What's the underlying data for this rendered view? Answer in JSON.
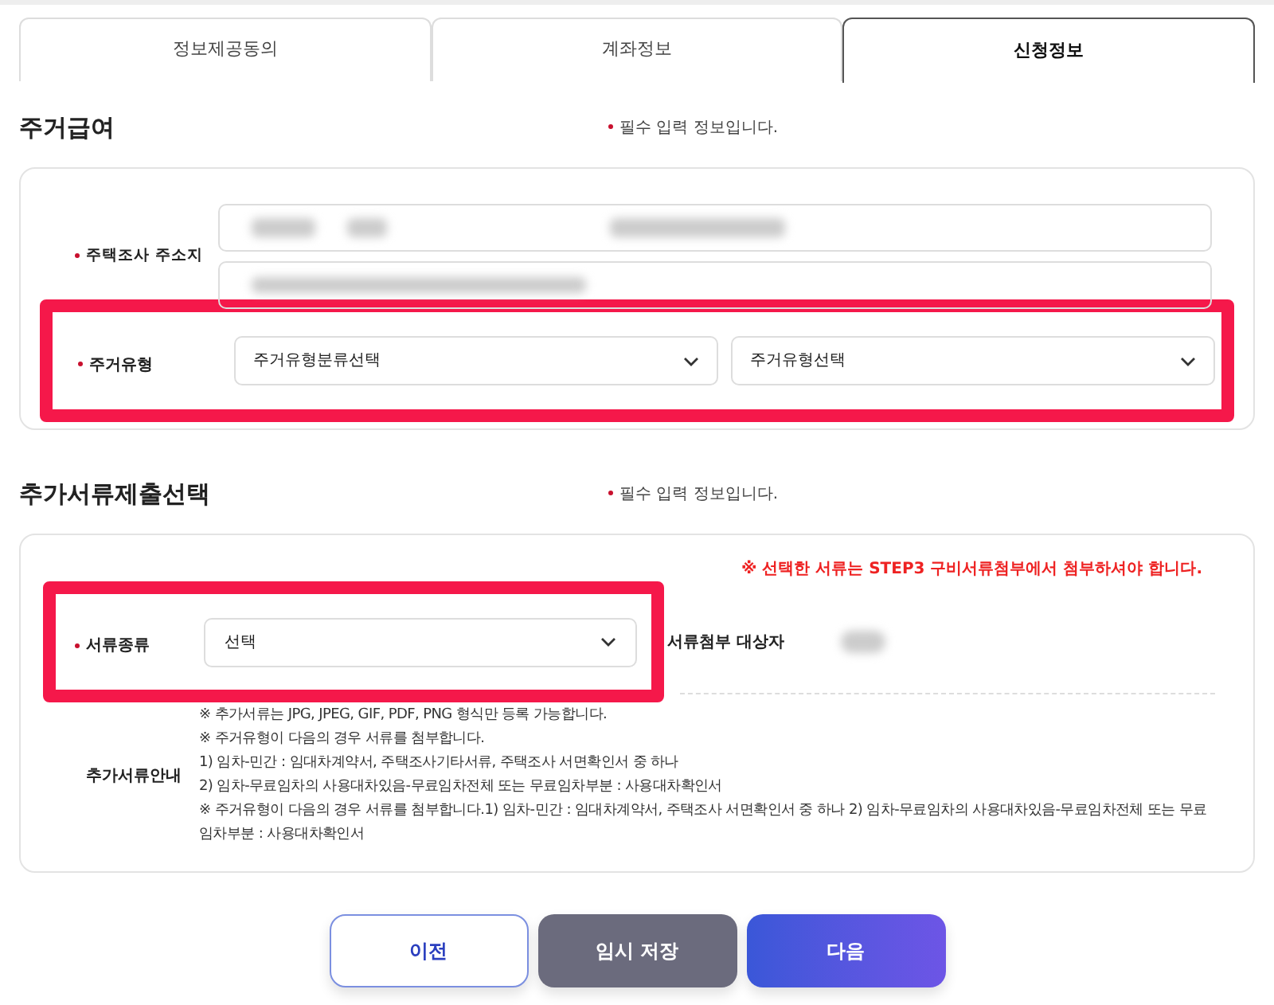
{
  "tabs": [
    {
      "label": "정보제공동의",
      "selected": false
    },
    {
      "label": "계좌정보",
      "selected": false
    },
    {
      "label": "신청정보",
      "selected": true
    }
  ],
  "housing_section": {
    "title": "주거급여",
    "required_note": "필수 입력 정보입니다.",
    "address_label": "주택조사 주소지",
    "type_label": "주거유형",
    "type_highlighted": true,
    "selects": [
      {
        "value": "주거유형분류선택"
      },
      {
        "value": "주거유형선택"
      }
    ]
  },
  "documents_section": {
    "title": "추가서류제출선택",
    "required_note": "필수 입력 정보입니다.",
    "warning": "※ 선택한 서류는 STEP3 구비서류첨부에서 첨부하셔야 합니다.",
    "doc_type_label": "서류종류",
    "doc_type_highlighted": true,
    "doc_type_select": "선택",
    "target_label": "서류첨부 대상자",
    "guide_label": "추가서류안내",
    "guide_lines": [
      "※ 추가서류는 JPG, JPEG, GIF, PDF, PNG 형식만 등록 가능합니다.",
      "※ 주거유형이 다음의 경우 서류를 첨부합니다.",
      "1) 임차-민간 : 임대차계약서, 주택조사기타서류, 주택조사 서면확인서 중 하나",
      "2) 임차-무료임차의 사용대차있음-무료임차전체 또는 무료임차부분 : 사용대차확인서",
      "※ 주거유형이 다음의 경우 서류를 첨부합니다.1) 임차-민간 : 임대차계약서, 주택조사 서면확인서 중 하나 2) 임차-무료임차의 사용대차있음-무료임차전체 또는 무료임차부분 : 사용대차확인서"
    ]
  },
  "buttons": [
    {
      "kind": "outline",
      "label": "이전"
    },
    {
      "kind": "secondary",
      "label": "임시 저장"
    },
    {
      "kind": "primary",
      "label": "다음"
    }
  ]
}
